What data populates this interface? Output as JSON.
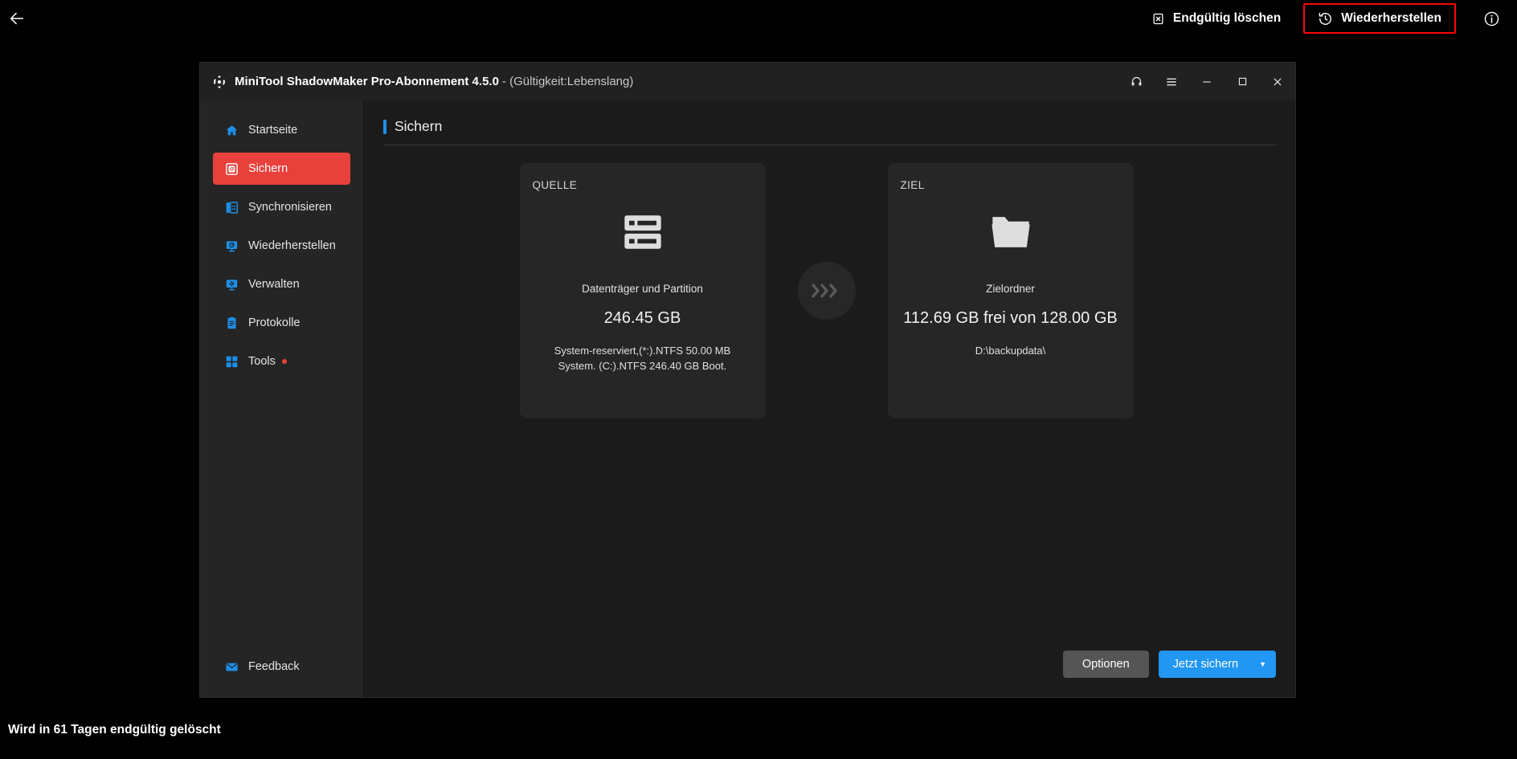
{
  "viewer": {
    "back_icon": "arrow-left-icon",
    "actions": [
      {
        "id": "delete-permanently",
        "label": "Endgültig löschen",
        "icon": "delete-permanently-icon",
        "highlighted": false
      },
      {
        "id": "restore",
        "label": "Wiederherstellen",
        "icon": "restore-clock-icon",
        "highlighted": true
      }
    ],
    "info_icon": "info-circle-icon",
    "status_text": "Wird in 61 Tagen endgültig gelöscht",
    "highlight_color": "#fb0606"
  },
  "window": {
    "logo_icon": "minitool-logo-icon",
    "title": "MiniTool ShadowMaker Pro-Abonnement 4.5.0",
    "title_suffix": "- (Gültigkeit:Lebenslang)",
    "controls": [
      {
        "id": "support",
        "icon": "headphones-icon"
      },
      {
        "id": "menu",
        "icon": "hamburger-menu-icon"
      },
      {
        "id": "minimize",
        "icon": "minimize-icon"
      },
      {
        "id": "maximize",
        "icon": "maximize-icon"
      },
      {
        "id": "close",
        "icon": "close-icon"
      }
    ]
  },
  "sidebar": {
    "items": [
      {
        "label": "Startseite",
        "icon": "home-icon",
        "active": false,
        "dot": false
      },
      {
        "label": "Sichern",
        "icon": "backup-icon",
        "active": true,
        "dot": false
      },
      {
        "label": "Synchronisieren",
        "icon": "sync-icon",
        "active": false,
        "dot": false
      },
      {
        "label": "Wiederherstellen",
        "icon": "restore-icon",
        "active": false,
        "dot": false
      },
      {
        "label": "Verwalten",
        "icon": "manage-icon",
        "active": false,
        "dot": false
      },
      {
        "label": "Protokolle",
        "icon": "logs-icon",
        "active": false,
        "dot": false
      },
      {
        "label": "Tools",
        "icon": "tools-icon",
        "active": false,
        "dot": true
      }
    ],
    "feedback": {
      "label": "Feedback",
      "icon": "envelope-icon"
    },
    "active_color": "#e8413c",
    "icon_color": "#1d8fe8"
  },
  "page": {
    "title": "Sichern",
    "accent_color": "#1d8fe8"
  },
  "source_card": {
    "label": "QUELLE",
    "icon": "disk-partition-icon",
    "subtitle": "Datenträger und Partition",
    "size": "246.45 GB",
    "detail": "System-reserviert,(*:).NTFS 50.00 MB System. (C:).NTFS 246.40 GB Boot."
  },
  "connector": {
    "icon": "chevrons-right-icon"
  },
  "target_card": {
    "label": "ZIEL",
    "icon": "folder-icon",
    "subtitle": "Zielordner",
    "size": "112.69 GB frei von 128.00 GB",
    "detail": "D:\\backupdata\\"
  },
  "actions": {
    "options_label": "Optionen",
    "backup_now_label": "Jetzt sichern",
    "caret_icon": "caret-down-icon",
    "primary_color": "#2196f3"
  }
}
